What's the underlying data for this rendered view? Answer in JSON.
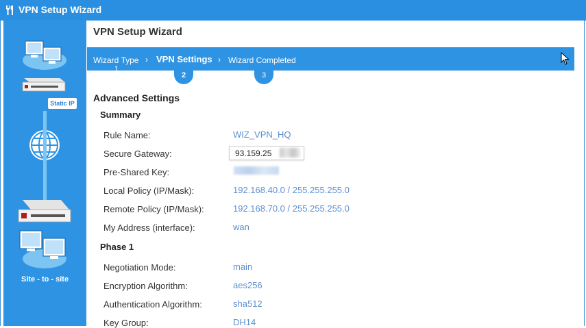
{
  "window": {
    "title": "VPN Setup Wizard"
  },
  "header": {
    "title": "VPN Setup Wizard"
  },
  "steps": [
    {
      "label": "Wizard Type",
      "number": "1"
    },
    {
      "label": "VPN Settings",
      "number": "2"
    },
    {
      "label": "Wizard Completed",
      "number": "3"
    }
  ],
  "sidebar": {
    "static_ip": "Static IP",
    "site_to_site": "Site - to - site"
  },
  "advanced": {
    "title": "Advanced Settings",
    "summary_title": "Summary",
    "phase1_title": "Phase 1",
    "rows": {
      "rule_name": {
        "label": "Rule Name:",
        "value": "WIZ_VPN_HQ"
      },
      "secure_gateway": {
        "label": "Secure Gateway:",
        "value": "93.159.25"
      },
      "pre_shared_key": {
        "label": "Pre-Shared Key:"
      },
      "local_policy": {
        "label": "Local Policy (IP/Mask):",
        "value": "192.168.40.0 / 255.255.255.0"
      },
      "remote_policy": {
        "label": "Remote Policy (IP/Mask):",
        "value": "192.168.70.0 / 255.255.255.0"
      },
      "my_address": {
        "label": "My Address (interface):",
        "value": "wan"
      },
      "negotiation_mode": {
        "label": "Negotiation Mode:",
        "value": "main"
      },
      "encryption": {
        "label": "Encryption Algorithm:",
        "value": "aes256"
      },
      "authentication": {
        "label": "Authentication Algorithm:",
        "value": "sha512"
      },
      "key_group": {
        "label": "Key Group:",
        "value": "DH14"
      }
    }
  },
  "colors": {
    "accent": "#2f93e3",
    "value_text": "#5b8fd0",
    "titlebar": "#2a8fe0"
  }
}
